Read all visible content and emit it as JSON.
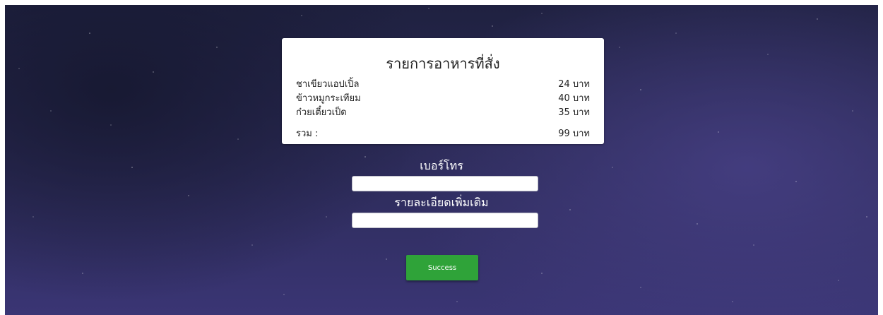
{
  "order": {
    "title": "รายการอาหารที่สั่ง",
    "items": [
      {
        "name": "ชาเขียวแอปเปิ้ล",
        "price": "24 บาท"
      },
      {
        "name": "ข้าวหมูกระเทียม",
        "price": "40 บาท"
      },
      {
        "name": "ก๋วยเตี๋ยวเป็ด",
        "price": "35 บาท"
      }
    ],
    "total_label": "รวม :",
    "total_value": "99 บาท"
  },
  "form": {
    "phone_label": "เบอร์โทร",
    "phone_value": "",
    "details_label": "รายละเอียดเพิ่มเติม",
    "details_value": ""
  },
  "actions": {
    "submit_label": "Success",
    "submit_color": "#2fa339"
  },
  "theme": {
    "background": "#2b2a56",
    "card": "#ffffff"
  }
}
